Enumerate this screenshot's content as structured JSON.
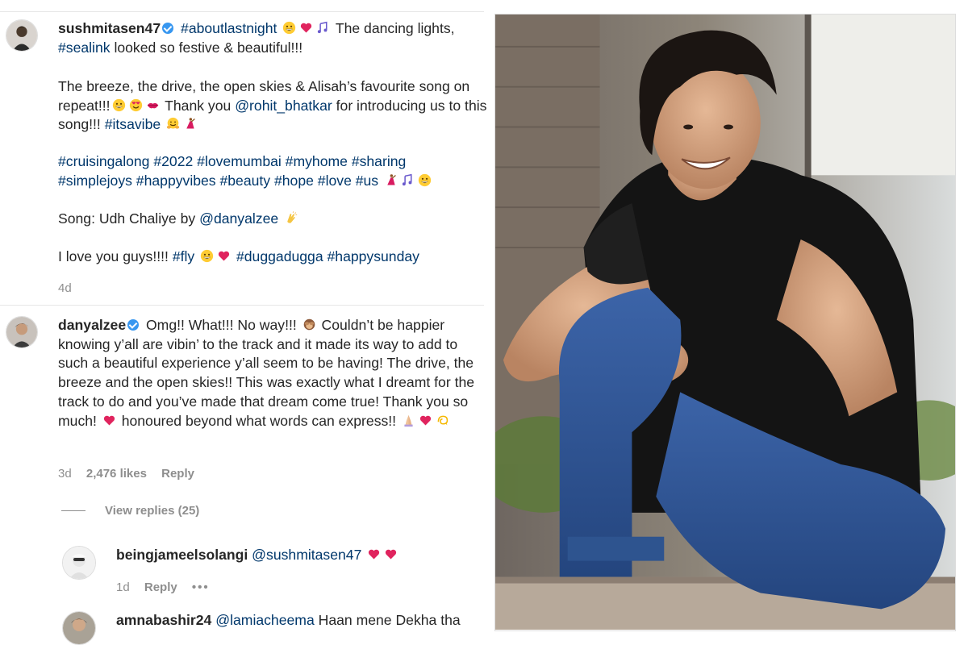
{
  "post": {
    "username": "sushmitasen47",
    "caption": {
      "line1_tag": "#aboutlastnight",
      "line1_text": "The dancing lights,",
      "line2_tag": "#sealink",
      "line2_text": "looked so festive & beautiful!!!",
      "para2_a": "The breeze, the drive, the open skies & Alisah’s favourite song on repeat!!!",
      "para2_b": "Thank you",
      "para2_mention": "@rohit_bhatkar",
      "para2_c": "for introducing us to this song!!!",
      "para2_tag": "#itsavibe",
      "tags_line1": "#cruisingalong #2022 #lovemumbai #myhome #sharing",
      "tags_line2": "#simplejoys #happyvibes #beauty #hope #love #us",
      "song_prefix": "Song: Udh Chaliye by",
      "song_mention": "@danyalzee",
      "love_text": "I love you guys!!!!",
      "love_tag1": "#fly",
      "love_tags": "#duggadugga #happysunday"
    },
    "time": "4d"
  },
  "reply": {
    "username": "danyalzee",
    "text_a": "Omg!! What!!! No way!!!",
    "text_b": "Couldn’t be happier knowing y’all are vibin’ to the track and it made its way to add to such a beautiful experience y’all seem to be having! The drive, the breeze and the open skies!! This was exactly what I dreamt for the track to do and you’ve made that dream come true! Thank you so much!",
    "text_c": "honoured beyond what words can express!!",
    "time": "3d",
    "likes": "2,476 likes",
    "reply_label": "Reply",
    "view_replies": "View replies (25)"
  },
  "sub_reply_1": {
    "username": "beingjameelsolangi",
    "mention": "@sushmitasen47",
    "time": "1d",
    "reply_label": "Reply",
    "more": "•••"
  },
  "sub_reply_2": {
    "username": "amnabashir24",
    "mention": "@lamiacheema",
    "text": "Haan mene Dekha tha"
  },
  "colors": {
    "link": "#00376b",
    "muted": "#8e8e8e",
    "verified": "#3897f0",
    "heart": "#ed4956"
  },
  "icons": [
    "verified-badge-icon",
    "grin-emoji-icon",
    "heart-emoji-icon",
    "music-notes-emoji-icon",
    "heart-eyes-emoji-icon",
    "kiss-lips-emoji-icon",
    "hug-emoji-icon",
    "dancer-emoji-icon",
    "clap-emoji-icon",
    "see-no-evil-emoji-icon",
    "pray-emoji-icon",
    "dizzy-emoji-icon"
  ]
}
